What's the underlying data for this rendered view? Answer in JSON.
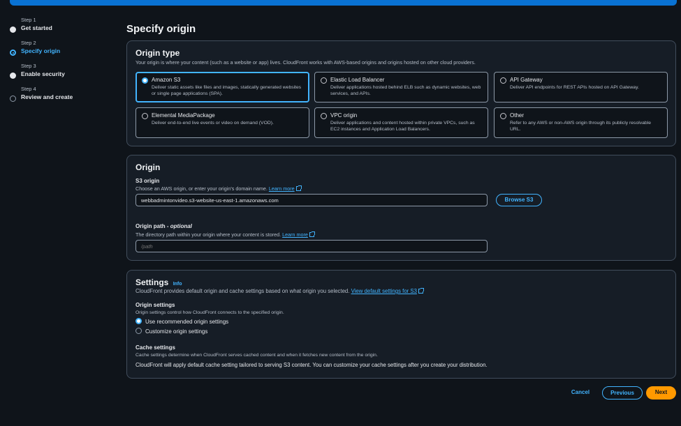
{
  "steps": [
    {
      "num": "Step 1",
      "name": "Get started"
    },
    {
      "num": "Step 2",
      "name": "Specify origin"
    },
    {
      "num": "Step 3",
      "name": "Enable security"
    },
    {
      "num": "Step 4",
      "name": "Review and create"
    }
  ],
  "page_title": "Specify origin",
  "origin_type": {
    "title": "Origin type",
    "description": "Your origin is where your content (such as a website or app) lives. CloudFront works with AWS-based origins and origins hosted on other cloud providers.",
    "options": [
      {
        "title": "Amazon S3",
        "desc": "Deliver static assets like files and images, statically generated websites or single page applications (SPA).",
        "selected": true
      },
      {
        "title": "Elastic Load Balancer",
        "desc": "Deliver applications hosted behind ELB such as dynamic websites, web services, and APIs."
      },
      {
        "title": "API Gateway",
        "desc": "Deliver API endpoints for REST APIs hosted on API Gateway."
      },
      {
        "title": "Elemental MediaPackage",
        "desc": "Deliver end-to-end live events or video on demand (VOD)."
      },
      {
        "title": "VPC origin",
        "desc": "Deliver applications and content hosted within private VPCs, such as EC2 instances and Application Load Balancers."
      },
      {
        "title": "Other",
        "desc": "Refer to any AWS or non-AWS origin through its publicly resolvable URL."
      }
    ]
  },
  "origin": {
    "title": "Origin",
    "s3_label": "S3 origin",
    "s3_desc": "Choose an AWS origin, or enter your origin's domain name.",
    "learn_more": "Learn more",
    "s3_value": "webbadmintonvideo.s3-website-us-east-1.amazonaws.com",
    "browse_label": "Browse S3",
    "path_label": "Origin path - ",
    "path_optional": "optional",
    "path_desc": "The directory path within your origin where your content is stored.",
    "path_placeholder": "/path"
  },
  "settings": {
    "title": "Settings",
    "info": "Info",
    "desc": "CloudFront provides default origin and cache settings based on what origin you selected.",
    "view_default": "View default settings for S3",
    "origin_settings_label": "Origin settings",
    "origin_settings_desc": "Origin settings control how CloudFront connects to the specified origin.",
    "opt_recommended": "Use recommended origin settings",
    "opt_customize": "Customize origin settings",
    "cache_label": "Cache settings",
    "cache_desc": "Cache settings determine when CloudFront serves cached content and when it fetches new content from the origin.",
    "cache_note": "CloudFront will apply default cache setting tailored to serving S3 content. You can customize your cache settings after you create your distribution."
  },
  "footer": {
    "cancel": "Cancel",
    "previous": "Previous",
    "next": "Next"
  },
  "colors": {
    "accent": "#42b4ff",
    "primary_button": "#ff9900",
    "background": "#0f141a"
  }
}
